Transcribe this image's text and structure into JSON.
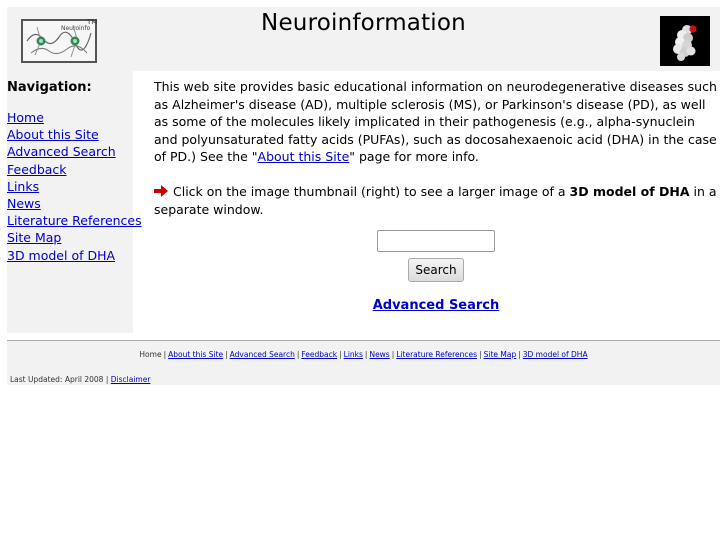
{
  "header": {
    "title": "Neuroinformation",
    "logo_tm": "TM",
    "logo_alt_text": "Neuroinfo"
  },
  "sidebar": {
    "heading": "Navigation:",
    "items": [
      {
        "label": "Home"
      },
      {
        "label": "About this Site"
      },
      {
        "label": "Advanced Search"
      },
      {
        "label": "Feedback"
      },
      {
        "label": "Links"
      },
      {
        "label": "News"
      },
      {
        "label": "Literature References"
      },
      {
        "label": "Site Map"
      },
      {
        "label": "3D model of DHA"
      }
    ]
  },
  "main": {
    "intro_text": "This web site provides basic educational information on neurodegenerative diseases such as Alzheimer's disease (AD), multiple sclerosis (MS), or Parkinson's disease (PD), as well as some of the molecules likely implicated in their pathogenesis (e.g., alpha-synuclein and polyunsaturated fatty acids (PUFAs), such as docosahexaenoic acid (DHA) in the case of PD.)  See the \"",
    "intro_link": "About this Site",
    "intro_tail": "\" page for more info.",
    "thumb_text_before": "Click on the image thumbnail (right) to see a larger image of a ",
    "thumb_text_bold": "3D model of DHA",
    "thumb_text_after": " in a separate window.",
    "search_input_value": "",
    "search_button_label": "Search",
    "advanced_search_label": "Advanced Search"
  },
  "footer": {
    "home_label": "Home",
    "links": [
      {
        "label": "About this Site"
      },
      {
        "label": "Advanced Search"
      },
      {
        "label": "Feedback"
      },
      {
        "label": "Links"
      },
      {
        "label": "News"
      },
      {
        "label": "Literature References"
      },
      {
        "label": "Site Map"
      },
      {
        "label": "3D model of DHA"
      }
    ],
    "separator": "|",
    "last_updated_text": "Last Updated: April 2008 | ",
    "disclaimer_label": "Disclaimer"
  },
  "colors": {
    "link": "#0000cc",
    "panel_background": "#f2f2f2",
    "arrow": "#cc0000"
  }
}
